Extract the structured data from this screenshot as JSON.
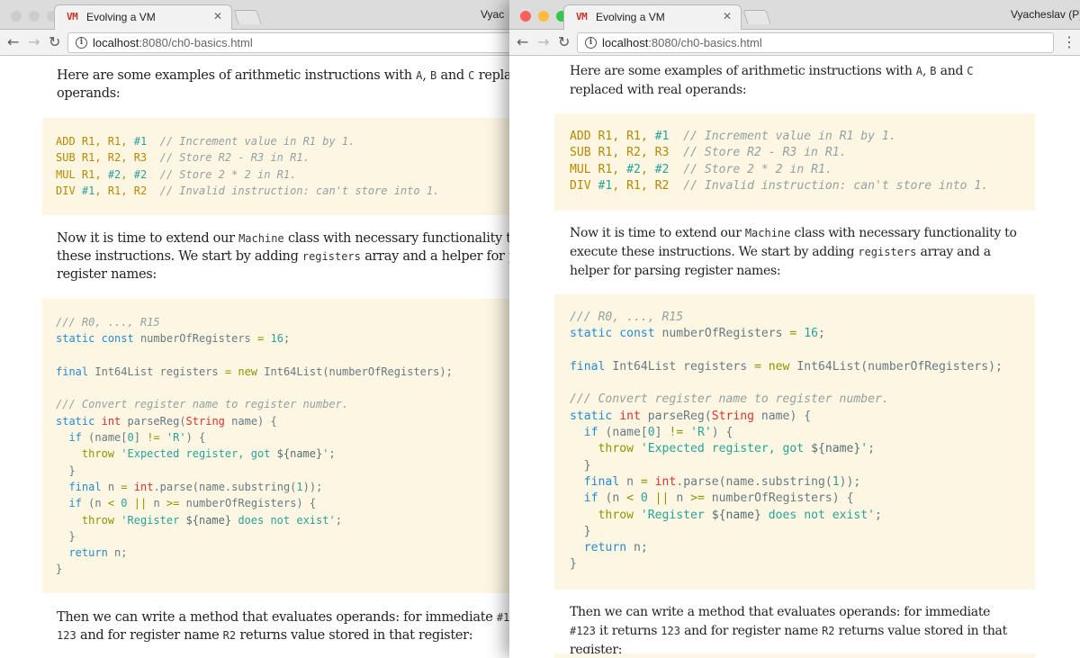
{
  "browser": {
    "tab_title": "Evolving a VM",
    "favicon": "VM",
    "url_host": "localhost",
    "url_path": ":8080/ch0-basics.html",
    "user_left": "Vyac",
    "user_right": "Vyacheslav (P)",
    "close_glyph": "✕",
    "icons": {
      "back": "arrow-left-icon",
      "forward": "arrow-right-icon",
      "reload": "reload-icon",
      "info": "info-icon",
      "menu": "more-vertical-icon"
    },
    "traffic_lights": [
      "#fc605c",
      "#fdbc40",
      "#34c84a"
    ],
    "traffic_lights_inactive": "#cdcdcd"
  },
  "article": {
    "p1_prefix": "Here are some examples of arithmetic instructions with ",
    "p1_a": "A",
    "p1_sep1": ", ",
    "p1_b": "B",
    "p1_and": " and ",
    "p1_c": "C",
    "p1_suffix": " replaced with real operands:",
    "p2_prefix": "Now it is time to extend our ",
    "p2_machine": "Machine",
    "p2_mid": " class with necessary functionality to execute these instructions. We start by adding ",
    "p2_registers": "registers",
    "p2_suffix": " array and a helper for parsing register names:",
    "p3_prefix": "Then we can write a method that evaluates operands: for immediate ",
    "p3_imm": "#123",
    "p3_mid1": " it returns ",
    "p3_val": "123",
    "p3_mid2": " and for register name ",
    "p3_reg": "R2",
    "p3_suffix": " returns value stored in that register:",
    "asm": {
      "l1": {
        "op": "ADD",
        "args1": " R1, R1, ",
        "imm": "#1",
        "pad": "  ",
        "comment": "// Increment value in R1 by 1."
      },
      "l2": {
        "op": "SUB",
        "args1": " R1, R2, R3",
        "pad": "  ",
        "comment": "// Store R2 - R3 in R1."
      },
      "l3": {
        "op": "MUL",
        "args1": " R1, ",
        "imm1": "#2",
        "sep": ", ",
        "imm2": "#2",
        "pad": "  ",
        "comment": "// Store 2 * 2 in R1."
      },
      "l4": {
        "op": "DIV",
        "sp": " ",
        "imm": "#1",
        "args1": ", R1, R2",
        "pad": "  ",
        "comment": "// Invalid instruction: can't store into 1."
      }
    },
    "dart": {
      "c1": "/// R0, ..., R15",
      "static": "static",
      "const": "const",
      "numberOfRegisters": "numberOfRegisters",
      "eq": "=",
      "sixteen": "16",
      "semi": ";",
      "final": "final",
      "int64list": "Int64List",
      "registers": "registers",
      "new": "new",
      "ctor_args": "(numberOfRegisters);",
      "c2": "/// Convert register name to register number.",
      "int": "int",
      "parseReg": "parseReg(",
      "String": "String",
      "name_param": "name) {",
      "if": "if",
      "cond1a": "(name[",
      "zero": "0",
      "cond1b": "] ",
      "neq": "!=",
      "str_R": "'R'",
      "cond1c": ") {",
      "throw": "throw",
      "str1a": "'Expected register, got ",
      "interp": "${name}",
      "str1b": "'",
      "close_brace": "}",
      "n_var": "n",
      "parse_call": "parse(name.substring(",
      "one": "1",
      "parse_end": "));",
      "dot": ".",
      "cond2a": "(n ",
      "lt": "<",
      "or": "||",
      "gte": ">=",
      "cond2b": " numberOfRegisters) {",
      "str2a": "'Register ",
      "str2b": " does not exist'",
      "return": "return",
      "return_val": "n;"
    }
  }
}
